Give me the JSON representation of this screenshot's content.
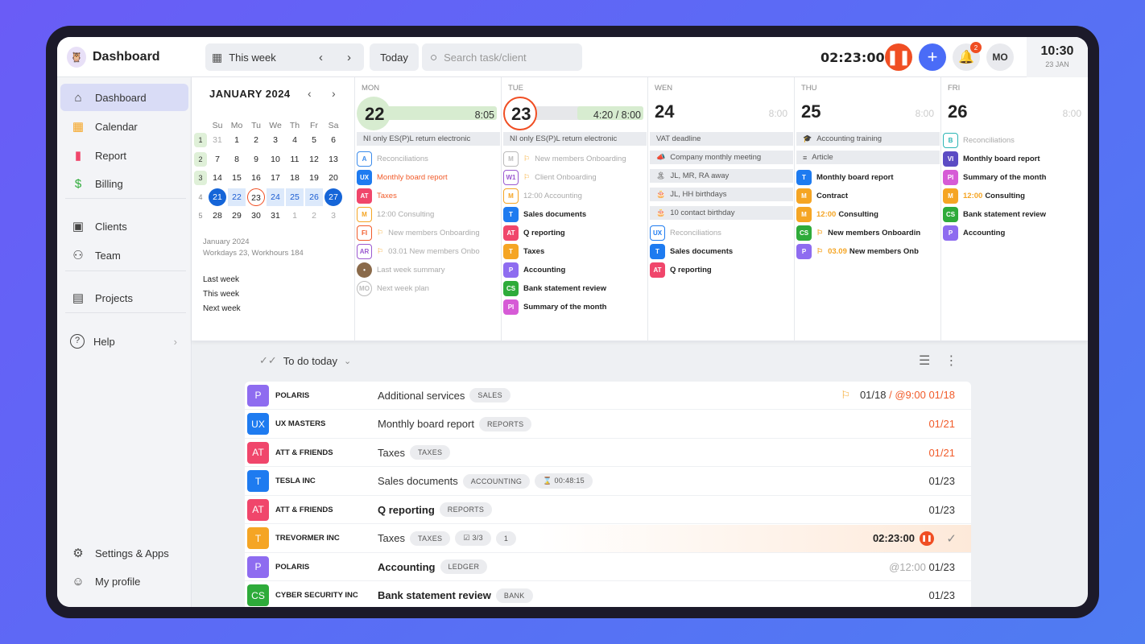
{
  "header": {
    "title": "Dashboard",
    "week_label": "This week",
    "today_label": "Today",
    "search_placeholder": "Search task/client",
    "timer": "02:23:00",
    "notif_count": "2",
    "avatar": "MO",
    "clock_time": "10:30",
    "clock_date": "23 JAN"
  },
  "sidebar": {
    "items": [
      {
        "label": "Dashboard",
        "icon": "home-icon",
        "active": true
      },
      {
        "label": "Calendar",
        "icon": "calendar-icon"
      },
      {
        "label": "Report",
        "icon": "chart-icon"
      },
      {
        "label": "Billing",
        "icon": "dollar-icon"
      },
      {
        "label": "Clients",
        "icon": "clients-icon"
      },
      {
        "label": "Team",
        "icon": "team-icon"
      },
      {
        "label": "Projects",
        "icon": "clipboard-icon"
      },
      {
        "label": "Help",
        "icon": "help-icon"
      },
      {
        "label": "Settings & Apps",
        "icon": "gear-icon"
      },
      {
        "label": "My profile",
        "icon": "user-icon"
      }
    ]
  },
  "mini_cal": {
    "title": "JANUARY 2024",
    "days": [
      "Su",
      "Mo",
      "Tu",
      "We",
      "Th",
      "Fr",
      "Sa"
    ],
    "weeks": [
      {
        "n": "1",
        "d": [
          "31",
          "1",
          "2",
          "3",
          "4",
          "5",
          "6"
        ]
      },
      {
        "n": "2",
        "d": [
          "7",
          "8",
          "9",
          "10",
          "11",
          "12",
          "13"
        ]
      },
      {
        "n": "3",
        "d": [
          "14",
          "15",
          "16",
          "17",
          "18",
          "19",
          "20"
        ]
      },
      {
        "n": "4",
        "d": [
          "21",
          "22",
          "23",
          "24",
          "25",
          "26",
          "27"
        ]
      },
      {
        "n": "5",
        "d": [
          "28",
          "29",
          "30",
          "31",
          "1",
          "2",
          "3"
        ]
      }
    ],
    "info1": "January 2024",
    "info2": "Workdays 23, Workhours 184",
    "links": [
      "Last week",
      "This week",
      "Next week"
    ]
  },
  "days": [
    {
      "name": "MON",
      "num": "22",
      "hours": "8:05",
      "events": [
        {
          "text": "NI only ES(P)L return electronic",
          "style": "band"
        },
        {
          "tag": "A",
          "color": "#3b8beb",
          "outline": true,
          "text": "Reconciliations",
          "style": "dim"
        },
        {
          "tag": "UX",
          "color": "#1e7bf0",
          "text": "Monthly board report",
          "style": "orange"
        },
        {
          "tag": "AT",
          "color": "#f0466b",
          "text": "Taxes",
          "style": "orange"
        },
        {
          "tag": "M",
          "color": "#f5a524",
          "outline": true,
          "text": "12:00 Consulting",
          "style": "dim"
        },
        {
          "tag": "FI",
          "color": "#f15b2a",
          "outline": true,
          "flag": true,
          "text": "New members Onboarding",
          "style": "dim"
        },
        {
          "tag": "AR",
          "color": "#9b59d0",
          "outline": true,
          "flag": true,
          "text": "03.01 New members Onbo",
          "style": "dim"
        },
        {
          "tag": "•",
          "color": "#8a6a4a",
          "round": true,
          "text": "Last week summary",
          "style": "dim"
        },
        {
          "tag": "MO",
          "color": "#bbb",
          "round": true,
          "outline": true,
          "text": "Next week plan",
          "style": "dim"
        }
      ]
    },
    {
      "name": "TUE",
      "num": "23",
      "hours": "4:20 / 8:00",
      "events": [
        {
          "text": "NI only ES(P)L return electronic",
          "style": "band"
        },
        {
          "tag": "M",
          "color": "#bbb",
          "outline": true,
          "flag": true,
          "text": "New members Onboarding",
          "style": "dim"
        },
        {
          "tag": "W1",
          "color": "#9b59d0",
          "outline": true,
          "flag": true,
          "text": "Client Onboarding",
          "style": "dim"
        },
        {
          "tag": "M",
          "color": "#f5a524",
          "outline": true,
          "text": "12:00 Accounting",
          "style": "dim"
        },
        {
          "tag": "T",
          "color": "#1e7bf0",
          "text": "Sales documents",
          "style": "bold"
        },
        {
          "tag": "AT",
          "color": "#f0466b",
          "text": "Q reporting",
          "style": "bold"
        },
        {
          "tag": "T",
          "color": "#f5a524",
          "text": "Taxes",
          "style": "bold"
        },
        {
          "tag": "P",
          "color": "#8e6cf0",
          "text": "Accounting",
          "style": "bold"
        },
        {
          "tag": "CS",
          "color": "#2eab3a",
          "text": "Bank statement review",
          "style": "bold"
        },
        {
          "tag": "PI",
          "color": "#d65bd6",
          "text": "Summary of the month",
          "style": "bold"
        }
      ]
    },
    {
      "name": "WEN",
      "num": "24",
      "hours": "8:00",
      "events": [
        {
          "text": "VAT deadline",
          "style": "band"
        },
        {
          "icon": "📣",
          "text": "Company monthly meeting",
          "style": "band"
        },
        {
          "icon": "🏝",
          "text": "JL, MR, RA away",
          "style": "band"
        },
        {
          "icon": "🎂",
          "text": "JL, HH birthdays",
          "style": "band"
        },
        {
          "icon": "🎂",
          "text": "10 contact birthday",
          "style": "band"
        },
        {
          "tag": "UX",
          "color": "#1e7bf0",
          "outline": true,
          "text": "Reconciliations",
          "style": "dim"
        },
        {
          "tag": "T",
          "color": "#1e7bf0",
          "text": "Sales documents",
          "style": "bold"
        },
        {
          "tag": "AT",
          "color": "#f0466b",
          "text": "Q reporting",
          "style": "bold"
        }
      ]
    },
    {
      "name": "THU",
      "num": "25",
      "hours": "8:00",
      "events": [
        {
          "icon": "🎓",
          "text": "Accounting training",
          "style": "band"
        },
        {
          "icon": "≡",
          "text": "Article",
          "style": "band"
        },
        {
          "tag": "T",
          "color": "#1e7bf0",
          "text": "Monthly board report",
          "style": "bold"
        },
        {
          "tag": "M",
          "color": "#f5a524",
          "text": "Contract",
          "style": "bold"
        },
        {
          "tag": "M",
          "color": "#f5a524",
          "time": "12:00",
          "text": "Consulting",
          "style": "bold"
        },
        {
          "tag": "CS",
          "color": "#2eab3a",
          "flag": true,
          "text": "New members Onboardin",
          "style": "bold"
        },
        {
          "tag": "P",
          "color": "#8e6cf0",
          "flag": true,
          "time": "03.09",
          "text": "New members Onb",
          "style": "bold"
        }
      ]
    },
    {
      "name": "FRI",
      "num": "26",
      "hours": "8:00",
      "events": [
        {
          "tag": "B",
          "color": "#2cb5b5",
          "outline": true,
          "text": "Reconciliations",
          "style": "dim"
        },
        {
          "tag": "VI",
          "color": "#5b4bc4",
          "text": "Monthly board report",
          "style": "bold"
        },
        {
          "tag": "PI",
          "color": "#d65bd6",
          "text": "Summary of the month",
          "style": "bold"
        },
        {
          "tag": "M",
          "color": "#f5a524",
          "time": "12:00",
          "text": "Consulting",
          "style": "bold"
        },
        {
          "tag": "CS",
          "color": "#2eab3a",
          "text": "Bank statement review",
          "style": "bold"
        },
        {
          "tag": "P",
          "color": "#8e6cf0",
          "text": "Accounting",
          "style": "bold"
        }
      ]
    }
  ],
  "todo": {
    "title": "To do today",
    "rows": [
      {
        "tag": "P",
        "color": "#8e6cf0",
        "client": "POLARIS",
        "task": "Additional services",
        "pills": [
          "SALES"
        ],
        "flag": true,
        "date": "01/18",
        "due": "@9:00 01/18",
        "date_color": "normal"
      },
      {
        "tag": "UX",
        "color": "#1e7bf0",
        "client": "UX MASTERS",
        "task": "Monthly board report",
        "pills": [
          "REPORTS"
        ],
        "date": "01/21",
        "date_color": "red"
      },
      {
        "tag": "AT",
        "color": "#f0466b",
        "client": "ATT & FRIENDS",
        "task": "Taxes",
        "pills": [
          "TAXES"
        ],
        "date": "01/21",
        "date_color": "red"
      },
      {
        "tag": "T",
        "color": "#1e7bf0",
        "client": "TESLA INC",
        "task": "Sales documents",
        "pills": [
          "ACCOUNTING",
          "⌛ 00:48:15"
        ],
        "date": "01/23"
      },
      {
        "tag": "AT",
        "color": "#f0466b",
        "client": "ATT & FRIENDS",
        "task": "Q reporting",
        "bold": true,
        "pills": [
          "REPORTS"
        ],
        "date": "01/23"
      },
      {
        "tag": "T",
        "color": "#f5a524",
        "client": "TREVORMER INC",
        "task": "Taxes",
        "pills": [
          "TAXES",
          "☑ 3/3",
          "1"
        ],
        "active": true,
        "timer": "02:23:00"
      },
      {
        "tag": "P",
        "color": "#8e6cf0",
        "client": "POLARIS",
        "task": "Accounting",
        "bold": true,
        "pills": [
          "LEDGER"
        ],
        "pre": "@12:00",
        "date": "01/23"
      },
      {
        "tag": "CS",
        "color": "#2eab3a",
        "client": "CYBER SECURITY INC",
        "task": "Bank statement review",
        "bold": true,
        "pills": [
          "BANK"
        ],
        "date": "01/23"
      }
    ]
  }
}
